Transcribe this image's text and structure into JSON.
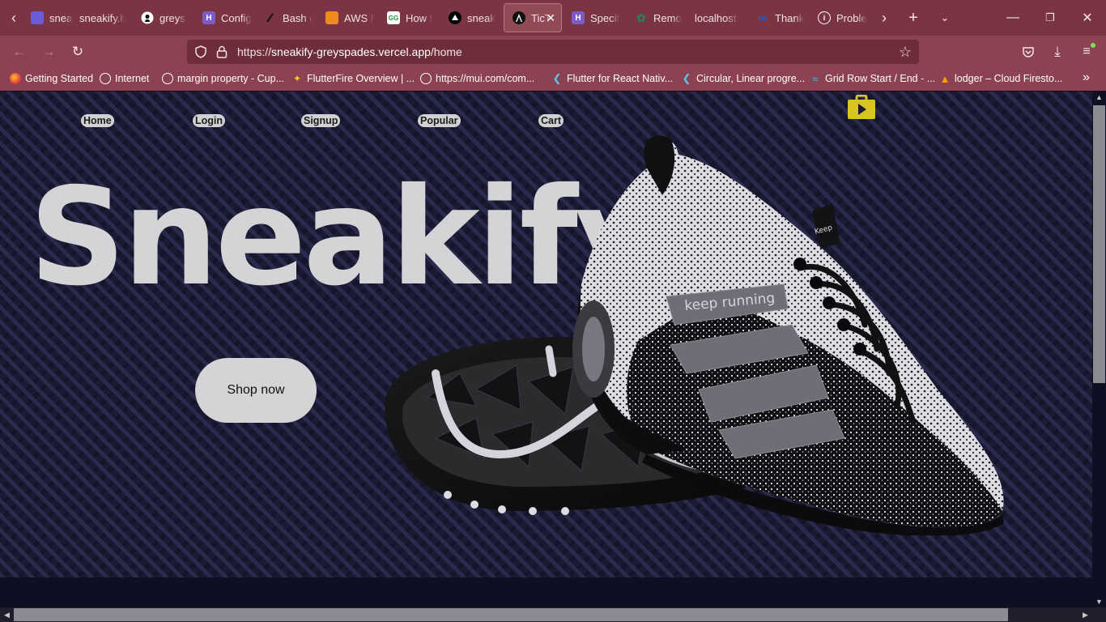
{
  "browser": {
    "tabs": [
      {
        "title": "sneaki",
        "icon": "sneakify-icon",
        "color": "#6b5bd6"
      },
      {
        "title": "sneakify.h",
        "icon": "blank-icon",
        "color": ""
      },
      {
        "title": "greyspades",
        "icon": "github-icon",
        "color": "#111111"
      },
      {
        "title": "Config",
        "icon": "heroku-icon",
        "color": "#7c5cc4"
      },
      {
        "title": "Bash c",
        "icon": "bash-icon",
        "color": "#222222"
      },
      {
        "title": "AWS N",
        "icon": "aws-icon",
        "color": "#f08a1c"
      },
      {
        "title": "How t",
        "icon": "geeks-icon",
        "color": "#2f8d46"
      },
      {
        "title": "sneak",
        "icon": "vercel-icon",
        "color": "#000000"
      },
      {
        "title": "TicT",
        "icon": "angular-icon",
        "color": "#111111"
      },
      {
        "title": "Specif",
        "icon": "heroku-icon",
        "color": "#7c5cc4"
      },
      {
        "title": "Remo",
        "icon": "git-icon",
        "color": "#2b7a5d"
      },
      {
        "title": "localhost:",
        "icon": "blank-icon",
        "color": ""
      },
      {
        "title": "Thank",
        "icon": "meta-icon",
        "color": "#1d5ed8"
      },
      {
        "title": "Proble",
        "icon": "info-icon",
        "color": ""
      }
    ],
    "url": {
      "protocol": "https://",
      "host": "sneakify-greyspades.vercel.app",
      "path": "/home"
    },
    "bookmarks": [
      {
        "label": "Getting Started",
        "icon": "firefox-icon"
      },
      {
        "label": "Internet",
        "icon": "globe-icon"
      },
      {
        "label": "margin property - Cup...",
        "icon": "globe-icon"
      },
      {
        "label": "FlutterFire Overview | ...",
        "icon": "flutterfire-icon"
      },
      {
        "label": "https://mui.com/com...",
        "icon": "globe-icon"
      },
      {
        "label": "Flutter for React Nativ...",
        "icon": "flutter-icon"
      },
      {
        "label": "Circular, Linear progre...",
        "icon": "flutter-icon"
      },
      {
        "label": "Grid Row Start / End - ...",
        "icon": "tailwind-icon"
      },
      {
        "label": "lodger – Cloud Firesto...",
        "icon": "firebase-icon"
      }
    ]
  },
  "site": {
    "nav": {
      "home": "Home",
      "login": "Login",
      "signup": "Signup",
      "popular": "Popular",
      "cart": "Cart"
    },
    "brand": "Sneakify",
    "cta": "Shop now",
    "shoe_text": "keep running",
    "shoe_tag": "Keep",
    "colors": {
      "cart_icon": "#d9c521",
      "heading": "#d4d4d6",
      "background": "#1a1a33"
    }
  }
}
